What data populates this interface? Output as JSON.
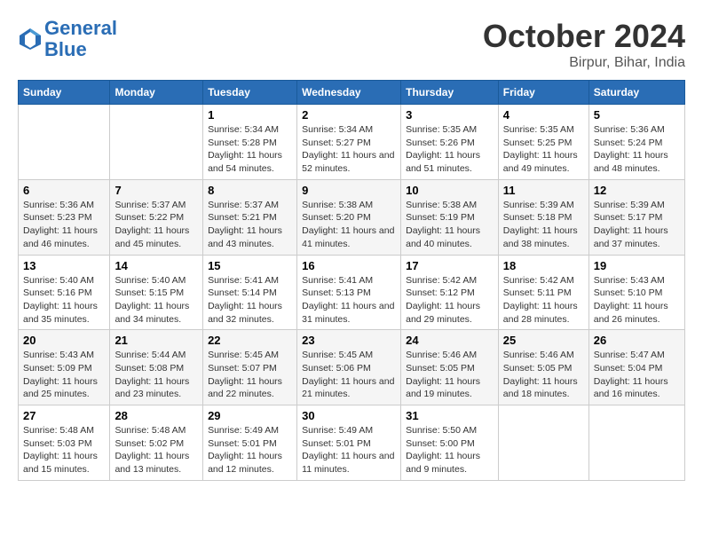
{
  "header": {
    "logo_line1": "General",
    "logo_line2": "Blue",
    "month": "October 2024",
    "location": "Birpur, Bihar, India"
  },
  "days_of_week": [
    "Sunday",
    "Monday",
    "Tuesday",
    "Wednesday",
    "Thursday",
    "Friday",
    "Saturday"
  ],
  "weeks": [
    [
      {
        "day": "",
        "sunrise": "",
        "sunset": "",
        "daylight": ""
      },
      {
        "day": "",
        "sunrise": "",
        "sunset": "",
        "daylight": ""
      },
      {
        "day": "1",
        "sunrise": "Sunrise: 5:34 AM",
        "sunset": "Sunset: 5:28 PM",
        "daylight": "Daylight: 11 hours and 54 minutes."
      },
      {
        "day": "2",
        "sunrise": "Sunrise: 5:34 AM",
        "sunset": "Sunset: 5:27 PM",
        "daylight": "Daylight: 11 hours and 52 minutes."
      },
      {
        "day": "3",
        "sunrise": "Sunrise: 5:35 AM",
        "sunset": "Sunset: 5:26 PM",
        "daylight": "Daylight: 11 hours and 51 minutes."
      },
      {
        "day": "4",
        "sunrise": "Sunrise: 5:35 AM",
        "sunset": "Sunset: 5:25 PM",
        "daylight": "Daylight: 11 hours and 49 minutes."
      },
      {
        "day": "5",
        "sunrise": "Sunrise: 5:36 AM",
        "sunset": "Sunset: 5:24 PM",
        "daylight": "Daylight: 11 hours and 48 minutes."
      }
    ],
    [
      {
        "day": "6",
        "sunrise": "Sunrise: 5:36 AM",
        "sunset": "Sunset: 5:23 PM",
        "daylight": "Daylight: 11 hours and 46 minutes."
      },
      {
        "day": "7",
        "sunrise": "Sunrise: 5:37 AM",
        "sunset": "Sunset: 5:22 PM",
        "daylight": "Daylight: 11 hours and 45 minutes."
      },
      {
        "day": "8",
        "sunrise": "Sunrise: 5:37 AM",
        "sunset": "Sunset: 5:21 PM",
        "daylight": "Daylight: 11 hours and 43 minutes."
      },
      {
        "day": "9",
        "sunrise": "Sunrise: 5:38 AM",
        "sunset": "Sunset: 5:20 PM",
        "daylight": "Daylight: 11 hours and 41 minutes."
      },
      {
        "day": "10",
        "sunrise": "Sunrise: 5:38 AM",
        "sunset": "Sunset: 5:19 PM",
        "daylight": "Daylight: 11 hours and 40 minutes."
      },
      {
        "day": "11",
        "sunrise": "Sunrise: 5:39 AM",
        "sunset": "Sunset: 5:18 PM",
        "daylight": "Daylight: 11 hours and 38 minutes."
      },
      {
        "day": "12",
        "sunrise": "Sunrise: 5:39 AM",
        "sunset": "Sunset: 5:17 PM",
        "daylight": "Daylight: 11 hours and 37 minutes."
      }
    ],
    [
      {
        "day": "13",
        "sunrise": "Sunrise: 5:40 AM",
        "sunset": "Sunset: 5:16 PM",
        "daylight": "Daylight: 11 hours and 35 minutes."
      },
      {
        "day": "14",
        "sunrise": "Sunrise: 5:40 AM",
        "sunset": "Sunset: 5:15 PM",
        "daylight": "Daylight: 11 hours and 34 minutes."
      },
      {
        "day": "15",
        "sunrise": "Sunrise: 5:41 AM",
        "sunset": "Sunset: 5:14 PM",
        "daylight": "Daylight: 11 hours and 32 minutes."
      },
      {
        "day": "16",
        "sunrise": "Sunrise: 5:41 AM",
        "sunset": "Sunset: 5:13 PM",
        "daylight": "Daylight: 11 hours and 31 minutes."
      },
      {
        "day": "17",
        "sunrise": "Sunrise: 5:42 AM",
        "sunset": "Sunset: 5:12 PM",
        "daylight": "Daylight: 11 hours and 29 minutes."
      },
      {
        "day": "18",
        "sunrise": "Sunrise: 5:42 AM",
        "sunset": "Sunset: 5:11 PM",
        "daylight": "Daylight: 11 hours and 28 minutes."
      },
      {
        "day": "19",
        "sunrise": "Sunrise: 5:43 AM",
        "sunset": "Sunset: 5:10 PM",
        "daylight": "Daylight: 11 hours and 26 minutes."
      }
    ],
    [
      {
        "day": "20",
        "sunrise": "Sunrise: 5:43 AM",
        "sunset": "Sunset: 5:09 PM",
        "daylight": "Daylight: 11 hours and 25 minutes."
      },
      {
        "day": "21",
        "sunrise": "Sunrise: 5:44 AM",
        "sunset": "Sunset: 5:08 PM",
        "daylight": "Daylight: 11 hours and 23 minutes."
      },
      {
        "day": "22",
        "sunrise": "Sunrise: 5:45 AM",
        "sunset": "Sunset: 5:07 PM",
        "daylight": "Daylight: 11 hours and 22 minutes."
      },
      {
        "day": "23",
        "sunrise": "Sunrise: 5:45 AM",
        "sunset": "Sunset: 5:06 PM",
        "daylight": "Daylight: 11 hours and 21 minutes."
      },
      {
        "day": "24",
        "sunrise": "Sunrise: 5:46 AM",
        "sunset": "Sunset: 5:05 PM",
        "daylight": "Daylight: 11 hours and 19 minutes."
      },
      {
        "day": "25",
        "sunrise": "Sunrise: 5:46 AM",
        "sunset": "Sunset: 5:05 PM",
        "daylight": "Daylight: 11 hours and 18 minutes."
      },
      {
        "day": "26",
        "sunrise": "Sunrise: 5:47 AM",
        "sunset": "Sunset: 5:04 PM",
        "daylight": "Daylight: 11 hours and 16 minutes."
      }
    ],
    [
      {
        "day": "27",
        "sunrise": "Sunrise: 5:48 AM",
        "sunset": "Sunset: 5:03 PM",
        "daylight": "Daylight: 11 hours and 15 minutes."
      },
      {
        "day": "28",
        "sunrise": "Sunrise: 5:48 AM",
        "sunset": "Sunset: 5:02 PM",
        "daylight": "Daylight: 11 hours and 13 minutes."
      },
      {
        "day": "29",
        "sunrise": "Sunrise: 5:49 AM",
        "sunset": "Sunset: 5:01 PM",
        "daylight": "Daylight: 11 hours and 12 minutes."
      },
      {
        "day": "30",
        "sunrise": "Sunrise: 5:49 AM",
        "sunset": "Sunset: 5:01 PM",
        "daylight": "Daylight: 11 hours and 11 minutes."
      },
      {
        "day": "31",
        "sunrise": "Sunrise: 5:50 AM",
        "sunset": "Sunset: 5:00 PM",
        "daylight": "Daylight: 11 hours and 9 minutes."
      },
      {
        "day": "",
        "sunrise": "",
        "sunset": "",
        "daylight": ""
      },
      {
        "day": "",
        "sunrise": "",
        "sunset": "",
        "daylight": ""
      }
    ]
  ]
}
